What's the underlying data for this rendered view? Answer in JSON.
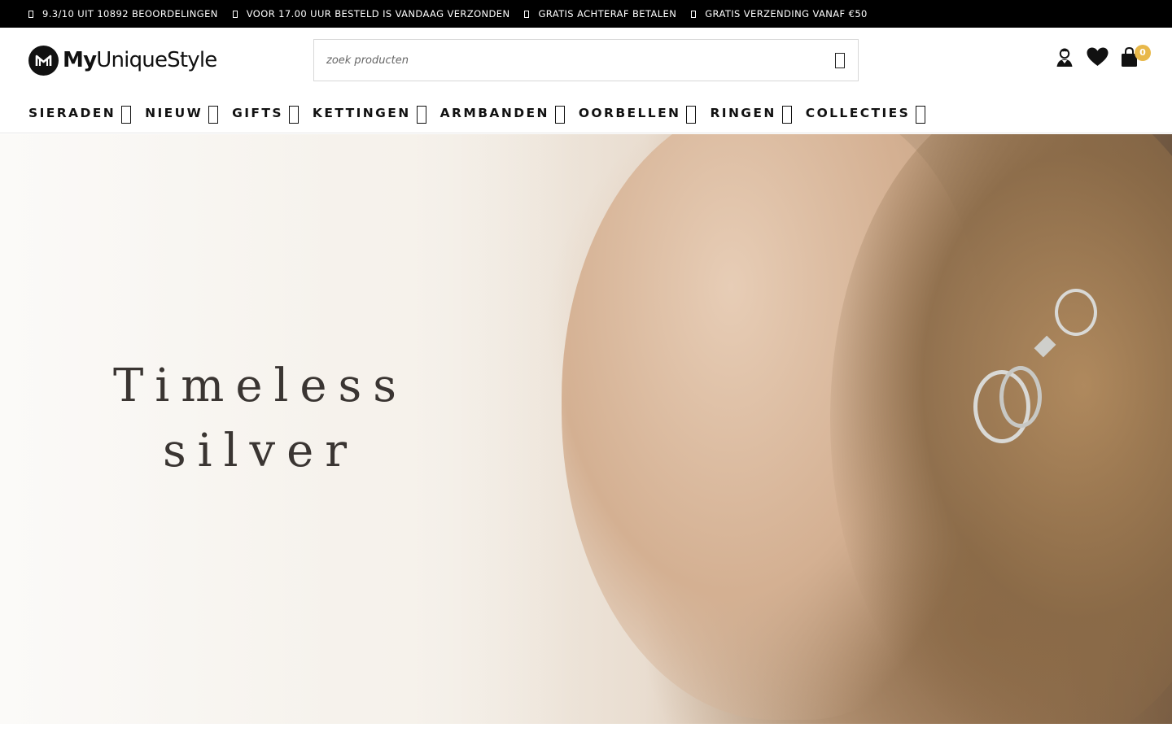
{
  "usp": [
    "9.3/10 UIT 10892 BEOORDELINGEN",
    "VOOR 17.00 UUR BESTELD IS VANDAAG VERZONDEN",
    "GRATIS ACHTERAF BETALEN",
    "GRATIS VERZENDING VANAF €50"
  ],
  "logo": {
    "bold": "My",
    "light": "UniqueStyle"
  },
  "search": {
    "placeholder": "zoek producten"
  },
  "cart": {
    "count": "0"
  },
  "nav": [
    "SIERADEN",
    "NIEUW",
    "GIFTS",
    "KETTINGEN",
    "ARMBANDEN",
    "OORBELLEN",
    "RINGEN",
    "COLLECTIES"
  ],
  "hero": {
    "line1": "Timeless",
    "line2": "silver"
  },
  "colors": {
    "topbar": "#000000",
    "badge": "#e8b84a",
    "text": "#111111"
  },
  "icons": [
    "account-icon",
    "heart-icon",
    "shopping-bag-icon",
    "search-icon",
    "chevron-down-icon"
  ]
}
